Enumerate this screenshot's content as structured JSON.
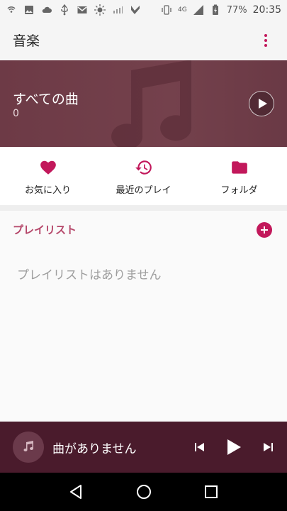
{
  "status_bar": {
    "network_label": "4G",
    "battery": "77%",
    "time": "20:35",
    "icons": [
      "wifi-calling-icon",
      "image-icon",
      "cloud-icon",
      "usb-icon",
      "email-icon",
      "brightness-icon",
      "signal-strength-icon",
      "check-icon",
      "vibrate-icon",
      "signal-icon",
      "battery-charging-icon"
    ]
  },
  "app_bar": {
    "title": "音楽",
    "overflow_icon": "more-vert-icon"
  },
  "hero": {
    "title": "すべての曲",
    "count": "0",
    "play_icon": "play-icon",
    "background_icon": "music-note-icon"
  },
  "quick_nav": {
    "items": [
      {
        "label": "お気に入り",
        "icon": "heart-icon"
      },
      {
        "label": "最近のプレイ",
        "icon": "history-icon"
      },
      {
        "label": "フォルダ",
        "icon": "folder-icon"
      }
    ]
  },
  "playlists": {
    "header": "プレイリスト",
    "add_icon": "add-circle-icon",
    "empty_text": "プレイリストはありません"
  },
  "mini_player": {
    "title": "曲がありません",
    "art_icon": "music-note-icon",
    "controls": [
      "skip-previous-icon",
      "play-icon",
      "skip-next-icon"
    ]
  },
  "nav_bar": {
    "buttons": [
      "back-icon",
      "home-icon",
      "recents-icon"
    ]
  },
  "colors": {
    "accent": "#c2185b",
    "hero_bg": "#6d3a46",
    "mini_player_bg": "#4a1b2c",
    "status_bar_bg": "#f5f5f5"
  }
}
